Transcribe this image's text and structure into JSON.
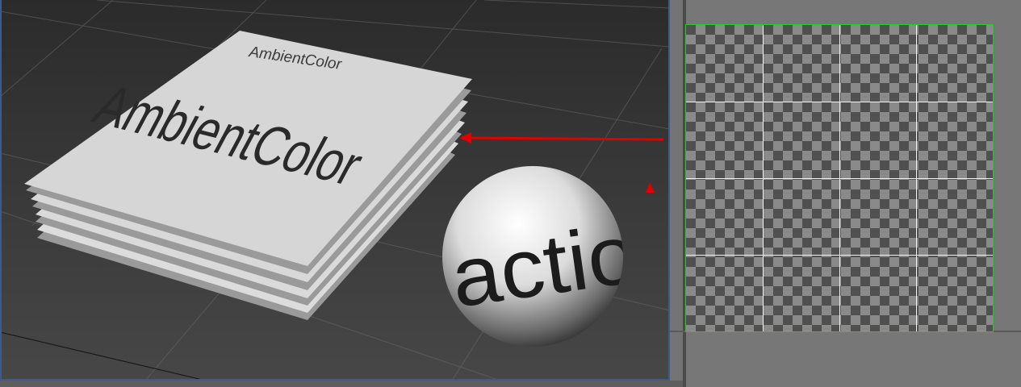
{
  "viewport": {
    "plane_label_small": "AmbientColor",
    "plane_label_large": "AmbientColor",
    "sphere_label": "actio"
  },
  "colors": {
    "background_top": "#2b2b2b",
    "background_bottom": "#444444",
    "plane": "#d6d6d6",
    "arrow": "#e00000",
    "uv_border": "#22cc22",
    "viewport_border": "#3d5a8a"
  },
  "icons": {
    "viewport_arrow": "red-arrow-icon",
    "marker": "red-triangle-icon"
  }
}
